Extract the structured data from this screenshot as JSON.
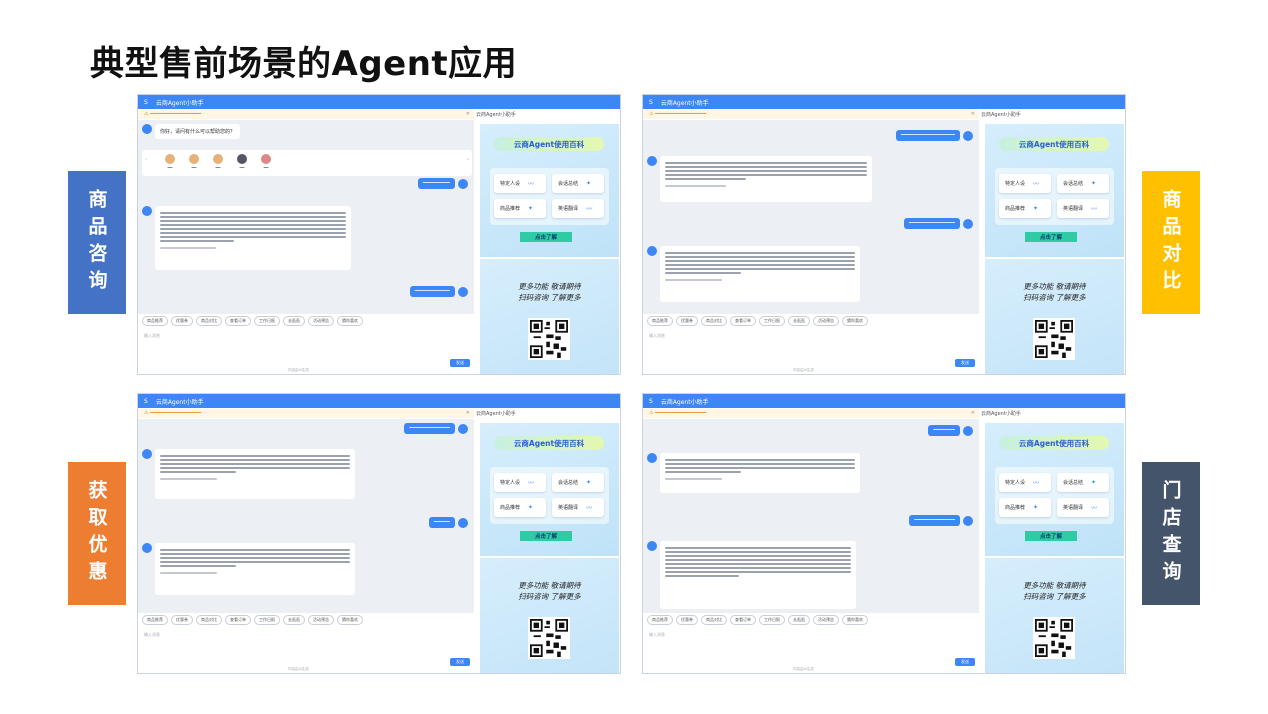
{
  "page_title": "典型售前场景的Agent应用",
  "labels": {
    "consult": "商品咨询",
    "compare": "商品对比",
    "coupon": "获取优惠",
    "store": "门店查询"
  },
  "app": {
    "window_title": "云商Agent小助手",
    "side_title": "云商Agent小助手",
    "input_placeholder": "输入消息",
    "send": "发送",
    "powered": "内容由AI生成",
    "greeting": "你好，请问有什么可以帮助您的？"
  },
  "promo": {
    "title": "云商Agent使用百科",
    "features": [
      "特定人设",
      "会话总结",
      "商品推荐",
      "英语翻译"
    ],
    "button": "点击了解",
    "text_line1": "更多功能 敬请期待",
    "text_line2": "扫码咨询 了解更多"
  },
  "quick_replies": [
    "商品推荐",
    "优惠券",
    "商品对比",
    "查看订单",
    "工作日报",
    "去逛逛",
    "活动预告",
    "猜你喜欢"
  ]
}
